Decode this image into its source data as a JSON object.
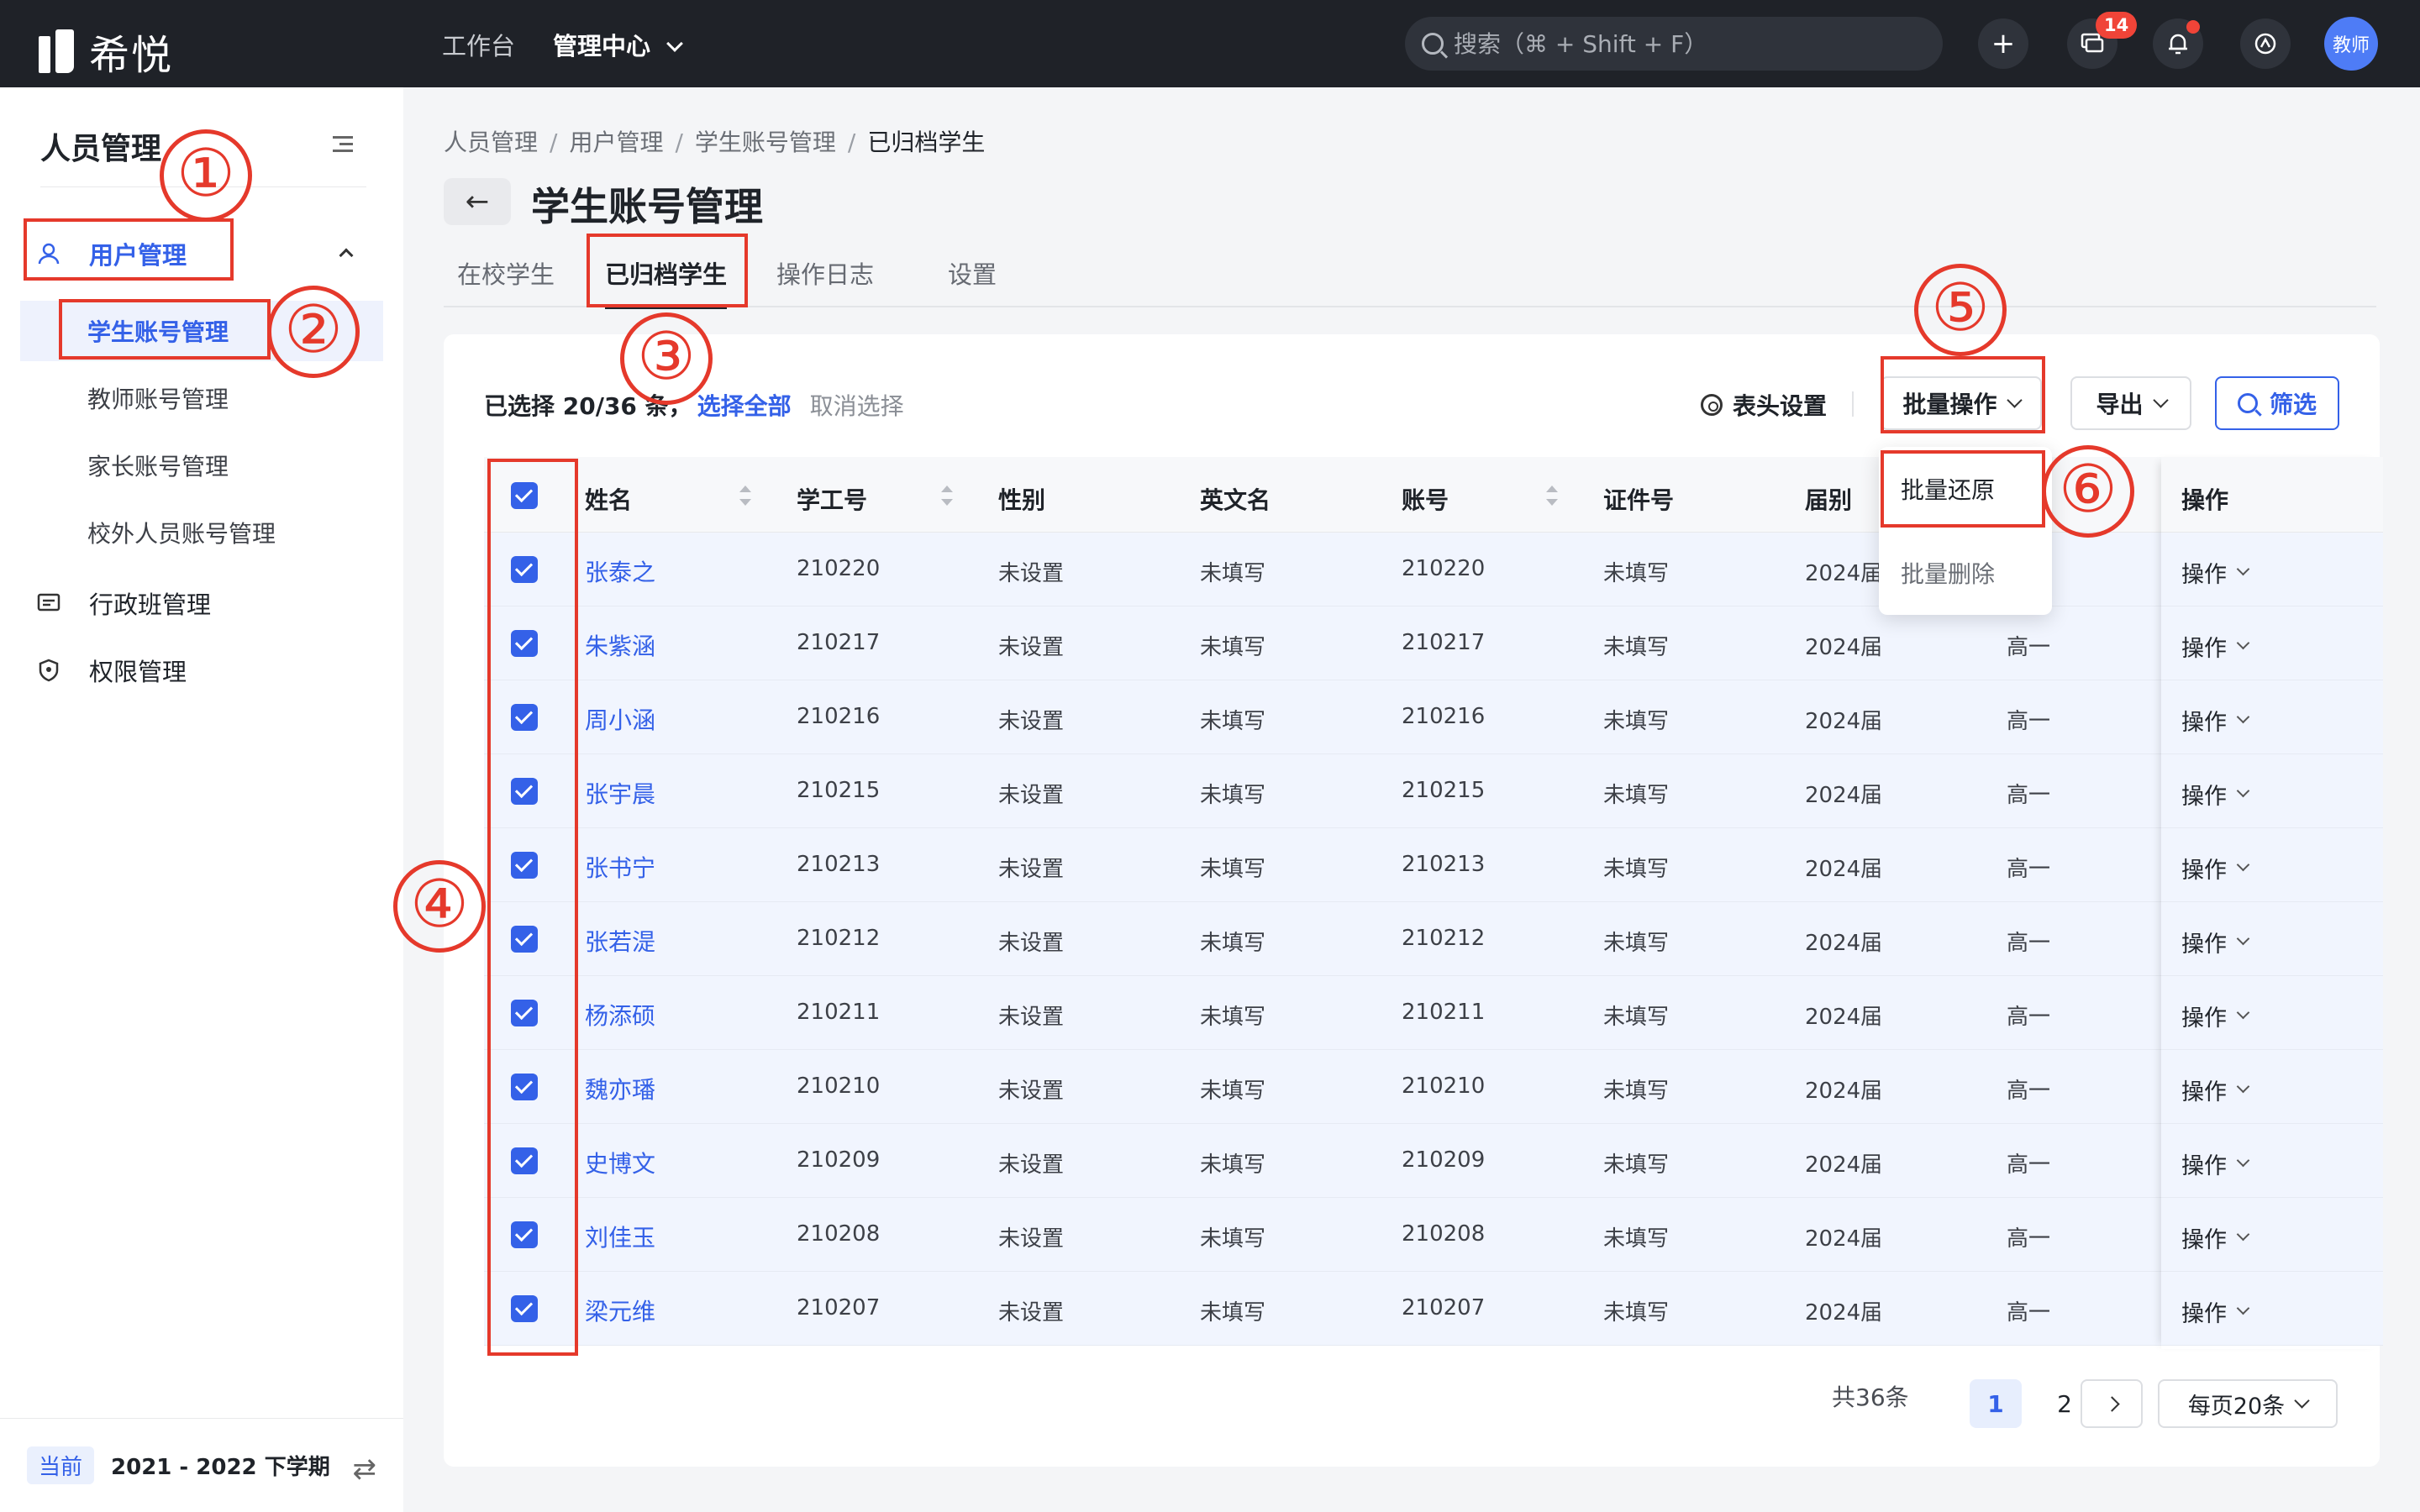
{
  "topbar": {
    "logo_text": "希悦",
    "nav": [
      {
        "label": "工作台"
      },
      {
        "label": "管理中心"
      }
    ],
    "search_placeholder": "搜索（⌘ + Shift + F）",
    "message_badge": "14",
    "avatar_label": "教师"
  },
  "sidebar": {
    "title": "人员管理",
    "group_user": "用户管理",
    "sub_items": [
      "学生账号管理",
      "教师账号管理",
      "家长账号管理",
      "校外人员账号管理"
    ],
    "group_class": "行政班管理",
    "group_permission": "权限管理",
    "term_tag": "当前",
    "term_value": "2021 - 2022 下学期"
  },
  "breadcrumb": [
    "人员管理",
    "用户管理",
    "学生账号管理",
    "已归档学生"
  ],
  "page_title": "学生账号管理",
  "tabs": [
    "在校学生",
    "已归档学生",
    "操作日志",
    "设置"
  ],
  "toolbar": {
    "selected_text": "已选择 20/36 条，",
    "select_all": "选择全部",
    "cancel_select": "取消选择",
    "header_settings": "表头设置",
    "batch_ops": "批量操作",
    "export": "导出",
    "filter": "筛选"
  },
  "dropdown": {
    "restore": "批量还原",
    "delete": "批量删除"
  },
  "table": {
    "columns": [
      "姓名",
      "学工号",
      "性别",
      "英文名",
      "账号",
      "证件号",
      "届别",
      "操作"
    ],
    "rows": [
      {
        "name": "张泰之",
        "id": "210220",
        "gender": "未设置",
        "en": "未填写",
        "account": "210220",
        "cert": "未填写",
        "year": "2024届",
        "grade": "",
        "op": "操作"
      },
      {
        "name": "朱紫涵",
        "id": "210217",
        "gender": "未设置",
        "en": "未填写",
        "account": "210217",
        "cert": "未填写",
        "year": "2024届",
        "grade": "高一",
        "op": "操作"
      },
      {
        "name": "周小涵",
        "id": "210216",
        "gender": "未设置",
        "en": "未填写",
        "account": "210216",
        "cert": "未填写",
        "year": "2024届",
        "grade": "高一",
        "op": "操作"
      },
      {
        "name": "张宇晨",
        "id": "210215",
        "gender": "未设置",
        "en": "未填写",
        "account": "210215",
        "cert": "未填写",
        "year": "2024届",
        "grade": "高一",
        "op": "操作"
      },
      {
        "name": "张书宁",
        "id": "210213",
        "gender": "未设置",
        "en": "未填写",
        "account": "210213",
        "cert": "未填写",
        "year": "2024届",
        "grade": "高一",
        "op": "操作"
      },
      {
        "name": "张若湜",
        "id": "210212",
        "gender": "未设置",
        "en": "未填写",
        "account": "210212",
        "cert": "未填写",
        "year": "2024届",
        "grade": "高一",
        "op": "操作"
      },
      {
        "name": "杨添硕",
        "id": "210211",
        "gender": "未设置",
        "en": "未填写",
        "account": "210211",
        "cert": "未填写",
        "year": "2024届",
        "grade": "高一",
        "op": "操作"
      },
      {
        "name": "魏亦璠",
        "id": "210210",
        "gender": "未设置",
        "en": "未填写",
        "account": "210210",
        "cert": "未填写",
        "year": "2024届",
        "grade": "高一",
        "op": "操作"
      },
      {
        "name": "史博文",
        "id": "210209",
        "gender": "未设置",
        "en": "未填写",
        "account": "210209",
        "cert": "未填写",
        "year": "2024届",
        "grade": "高一",
        "op": "操作"
      },
      {
        "name": "刘佳玉",
        "id": "210208",
        "gender": "未设置",
        "en": "未填写",
        "account": "210208",
        "cert": "未填写",
        "year": "2024届",
        "grade": "高一",
        "op": "操作"
      },
      {
        "name": "梁元维",
        "id": "210207",
        "gender": "未设置",
        "en": "未填写",
        "account": "210207",
        "cert": "未填写",
        "year": "2024届",
        "grade": "高一",
        "op": "操作"
      }
    ]
  },
  "pagination": {
    "total": "共36条",
    "pages": [
      "1",
      "2"
    ],
    "per_page": "每页20条"
  },
  "annotations": [
    "①",
    "②",
    "③",
    "④",
    "⑤",
    "⑥"
  ],
  "colors": {
    "accent": "#3461e8",
    "annotation": "#e5392b",
    "topbar": "#1f2228"
  }
}
